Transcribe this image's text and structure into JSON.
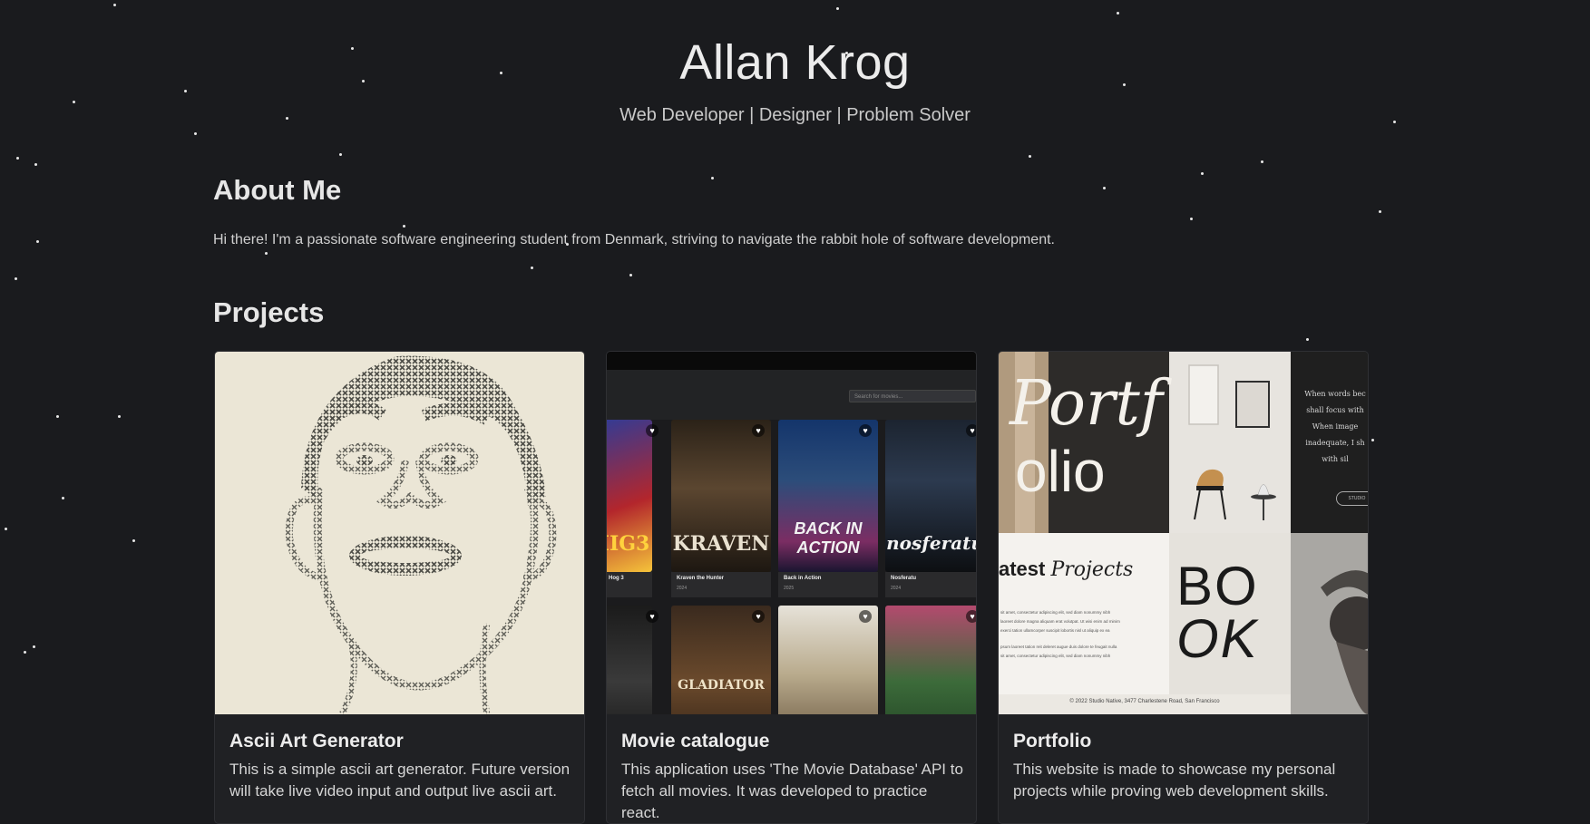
{
  "header": {
    "title": "Allan Krog",
    "subtitle": "Web Developer | Designer | Problem Solver"
  },
  "about": {
    "heading": "About Me",
    "text": "Hi there! I'm a passionate software engineering student from Denmark, striving to navigate the rabbit hole of software development."
  },
  "projects": {
    "heading": "Projects",
    "items": [
      {
        "title": "Ascii Art Generator",
        "description": "This is a simple ascii art generator. Future version will take live video input and output live ascii art."
      },
      {
        "title": "Movie catalogue",
        "description": "This application uses 'The Movie Database' API to fetch all movies. It was developed to practice react.",
        "thumbnail": {
          "search_placeholder": "Search for movies...",
          "posters": [
            {
              "name": "Hog 3",
              "year": "",
              "word": "IIG3"
            },
            {
              "name": "Kraven the Hunter",
              "year": "2024",
              "word": "KRAVEN"
            },
            {
              "name": "Back in Action",
              "year": "2025",
              "word": "BACK IN ACTION"
            },
            {
              "name": "Nosferatu",
              "year": "2024",
              "word": "nosferatu"
            }
          ],
          "bottom_row_words": [
            "",
            "GLADIATOR",
            "",
            ""
          ]
        }
      },
      {
        "title": "Portfolio",
        "description": "This website is made to showcase my personal projects while proving web development skills.",
        "thumbnail": {
          "hero_text_1": "Portf",
          "hero_text_2": "olio",
          "quote_lines": [
            "When words bec",
            "shall focus with",
            "When image",
            "inadequate, I sh",
            "with sil"
          ],
          "button_text": "STUDIO",
          "latest_1": "atest",
          "latest_2": "Projects",
          "lorem_lines": [
            "sit amet, consectetur adipiscing elit, sed diam nonummy nibh",
            "laoreet dolore magna aliquam erat volutpat. Ut wisi enim ad minim",
            "exerci tation ullamcorper suscipit lobortis nisl ut aliquip ex ea",
            "psum laoreet tation reit deleret augue duis dolore te feugait nulla",
            "sit amet, consectetur adipiscing elit, sed diam nonummy nibh"
          ],
          "book_1": "BO",
          "book_2": "OK",
          "footer": "© 2022 Studio Native, 3477 Charlestene Road, San Francisco"
        }
      }
    ]
  },
  "colors": {
    "background": "#1a1b1e",
    "card": "#202124",
    "text": "#d8d8d8"
  }
}
